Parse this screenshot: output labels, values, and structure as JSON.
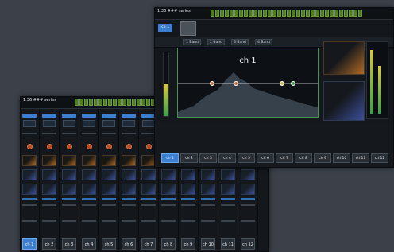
{
  "back_window": {
    "title": "1.36  ### series",
    "channels": [
      "ch 1",
      "ch 2",
      "ch 3",
      "ch 4",
      "ch 5",
      "ch 6",
      "ch 7",
      "ch 8",
      "ch 9",
      "ch 10",
      "ch 11",
      "ch 12"
    ],
    "selected_index": 0
  },
  "front_window": {
    "title": "1.36  ### series",
    "channel_tag": "ch 1",
    "eq_title": "ch 1",
    "tabs": [
      "1  Band",
      "2  Band",
      "3  Band",
      "4  Band"
    ],
    "bottom_channels": [
      "ch 1",
      "ch 2",
      "ch 3",
      "ch 4",
      "ch 5",
      "ch 6",
      "ch 7",
      "ch 8",
      "ch 9",
      "ch 10",
      "ch 11",
      "ch 12"
    ],
    "selected_index": 0
  },
  "colors": {
    "accent_blue": "#3c7fd0",
    "eq_border": "#3a9a4a",
    "knob_orange": "#e0743c"
  }
}
